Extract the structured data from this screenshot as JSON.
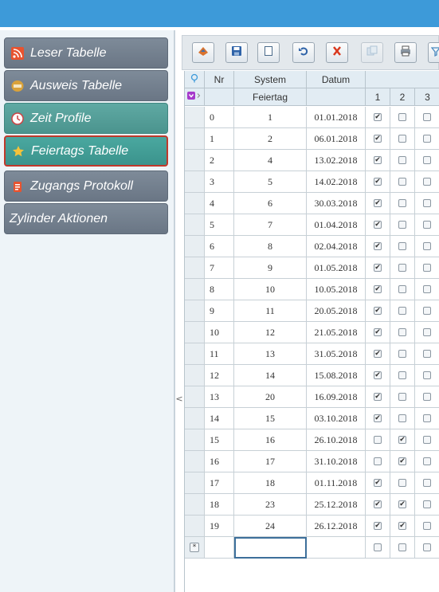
{
  "sidebar": {
    "items": [
      {
        "label": "Leser Tabelle",
        "icon": "rss-icon"
      },
      {
        "label": "Ausweis Tabelle",
        "icon": "card-icon"
      },
      {
        "label": "Zeit Profile",
        "icon": "clock-icon"
      },
      {
        "label": "Feiertags Tabelle",
        "icon": "star-icon"
      },
      {
        "label": "Zugangs Protokoll",
        "icon": "clipboard-icon"
      },
      {
        "label": "Zylinder Aktionen",
        "icon": ""
      }
    ]
  },
  "splitter": {
    "glyph": "<"
  },
  "table": {
    "headers": {
      "nr": "Nr",
      "system": "System",
      "datum": "Datum",
      "feiertag": "Feiertag",
      "day1": "1",
      "day2": "2",
      "day3": "3"
    },
    "rows": [
      {
        "nr": "0",
        "feiertag": "1",
        "datum": "01.01.2018",
        "c1": true,
        "c2": false,
        "c3": false
      },
      {
        "nr": "1",
        "feiertag": "2",
        "datum": "06.01.2018",
        "c1": true,
        "c2": false,
        "c3": false
      },
      {
        "nr": "2",
        "feiertag": "4",
        "datum": "13.02.2018",
        "c1": true,
        "c2": false,
        "c3": false
      },
      {
        "nr": "3",
        "feiertag": "5",
        "datum": "14.02.2018",
        "c1": true,
        "c2": false,
        "c3": false
      },
      {
        "nr": "4",
        "feiertag": "6",
        "datum": "30.03.2018",
        "c1": true,
        "c2": false,
        "c3": false
      },
      {
        "nr": "5",
        "feiertag": "7",
        "datum": "01.04.2018",
        "c1": true,
        "c2": false,
        "c3": false
      },
      {
        "nr": "6",
        "feiertag": "8",
        "datum": "02.04.2018",
        "c1": true,
        "c2": false,
        "c3": false
      },
      {
        "nr": "7",
        "feiertag": "9",
        "datum": "01.05.2018",
        "c1": true,
        "c2": false,
        "c3": false
      },
      {
        "nr": "8",
        "feiertag": "10",
        "datum": "10.05.2018",
        "c1": true,
        "c2": false,
        "c3": false
      },
      {
        "nr": "9",
        "feiertag": "11",
        "datum": "20.05.2018",
        "c1": true,
        "c2": false,
        "c3": false
      },
      {
        "nr": "10",
        "feiertag": "12",
        "datum": "21.05.2018",
        "c1": true,
        "c2": false,
        "c3": false
      },
      {
        "nr": "11",
        "feiertag": "13",
        "datum": "31.05.2018",
        "c1": true,
        "c2": false,
        "c3": false
      },
      {
        "nr": "12",
        "feiertag": "14",
        "datum": "15.08.2018",
        "c1": true,
        "c2": false,
        "c3": false
      },
      {
        "nr": "13",
        "feiertag": "20",
        "datum": "16.09.2018",
        "c1": true,
        "c2": false,
        "c3": false
      },
      {
        "nr": "14",
        "feiertag": "15",
        "datum": "03.10.2018",
        "c1": true,
        "c2": false,
        "c3": false
      },
      {
        "nr": "15",
        "feiertag": "16",
        "datum": "26.10.2018",
        "c1": false,
        "c2": true,
        "c3": false
      },
      {
        "nr": "16",
        "feiertag": "17",
        "datum": "31.10.2018",
        "c1": false,
        "c2": true,
        "c3": false
      },
      {
        "nr": "17",
        "feiertag": "18",
        "datum": "01.11.2018",
        "c1": true,
        "c2": false,
        "c3": false
      },
      {
        "nr": "18",
        "feiertag": "23",
        "datum": "25.12.2018",
        "c1": true,
        "c2": true,
        "c3": false
      },
      {
        "nr": "19",
        "feiertag": "24",
        "datum": "26.12.2018",
        "c1": true,
        "c2": true,
        "c3": false
      }
    ],
    "new_row_marker": "*",
    "check_glyph": "✔"
  },
  "colors": {
    "topbar": "#3d9ad9",
    "nav": "#7e8b99",
    "nav_teal": "#5fa9a3",
    "active_border": "#c0392b"
  }
}
